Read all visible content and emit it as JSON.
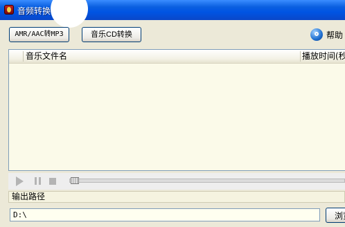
{
  "window": {
    "title": "音频转换"
  },
  "toolbar": {
    "amr_label": "AMR/AAC转MP3",
    "cd_label": "音乐CD转换",
    "help_label": "帮助"
  },
  "file_list": {
    "columns": [
      "音乐文件名",
      "播放时间(秒"
    ],
    "rows": []
  },
  "output": {
    "label": "输出路径",
    "path": "D:\\",
    "browse_label": "浏览"
  },
  "colors": {
    "titlebar": "#0054e3",
    "list_bg": "#fbfae9",
    "window_bg": "#ece9d8"
  }
}
